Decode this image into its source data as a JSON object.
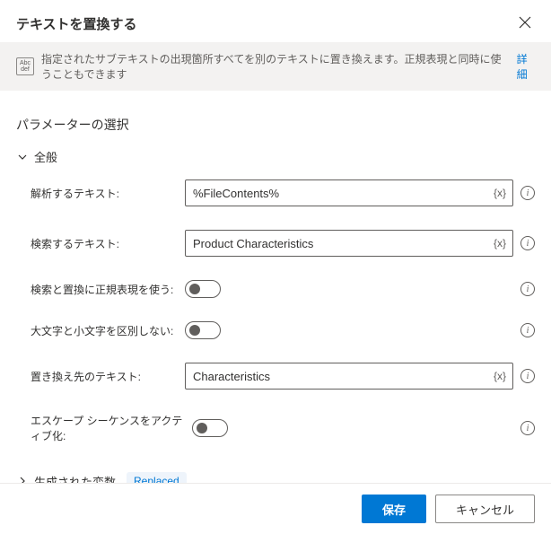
{
  "dialog": {
    "title": "テキストを置換する",
    "info_text": "指定されたサブテキストの出現箇所すべてを別のテキストに置き換えます。正規表現と同時に使うこともできます",
    "info_link": "詳細",
    "section_title": "パラメーターの選択"
  },
  "groups": {
    "general": "全般",
    "generated": "生成された変数",
    "generated_badge": "Replaced"
  },
  "params": {
    "parse_text": {
      "label": "解析するテキスト:",
      "value": "%FileContents%"
    },
    "search_text": {
      "label": "検索するテキスト:",
      "value": "Product Characteristics"
    },
    "use_regex": {
      "label": "検索と置換に正規表現を使う:"
    },
    "ignore_case": {
      "label": "大文字と小文字を区別しない:"
    },
    "replace_text": {
      "label": "置き換え先のテキスト:",
      "value": "Characteristics"
    },
    "escape_seq": {
      "label": "エスケープ シーケンスをアクティブ化:"
    }
  },
  "var_token": "{x}",
  "footer": {
    "save": "保存",
    "cancel": "キャンセル"
  }
}
